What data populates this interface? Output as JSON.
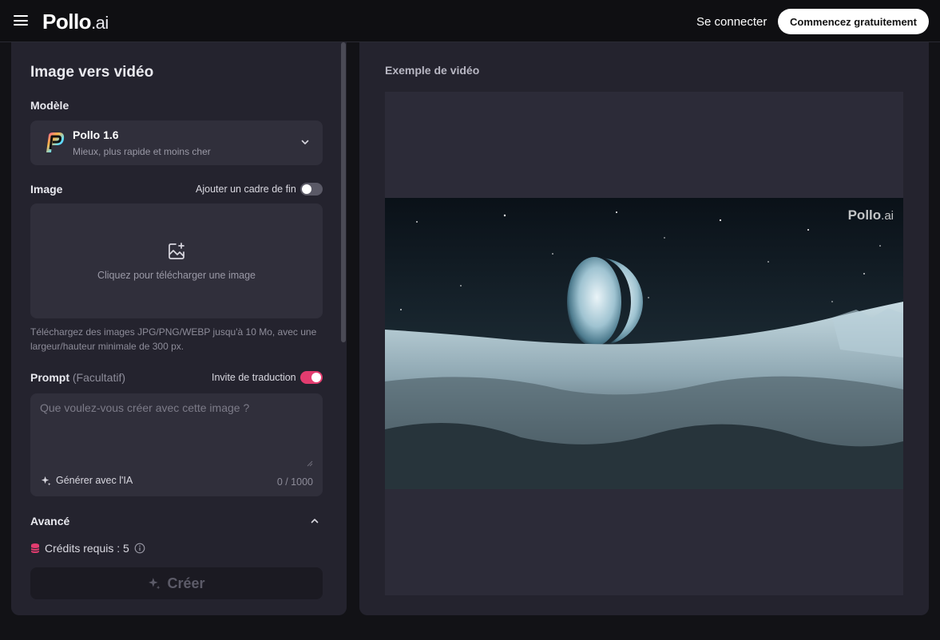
{
  "header": {
    "logo_main": "Pollo",
    "logo_suffix": ".ai",
    "signin_label": "Se connecter",
    "cta_label": "Commencez gratuitement"
  },
  "form": {
    "title": "Image vers vidéo",
    "model_label": "Modèle",
    "model": {
      "name": "Pollo 1.6",
      "description": "Mieux, plus rapide et moins cher"
    },
    "image_label": "Image",
    "end_frame_label": "Ajouter un cadre de fin",
    "end_frame_enabled": false,
    "upload_text": "Cliquez pour télécharger une image",
    "upload_hint": "Téléchargez des images JPG/PNG/WEBP jusqu'à 10 Mo, avec une largeur/hauteur minimale de 300 px.",
    "prompt_label": "Prompt",
    "prompt_optional": "(Facultatif)",
    "translate_label": "Invite de traduction",
    "translate_enabled": true,
    "prompt_placeholder": "Que voulez-vous créer avec cette image ?",
    "generate_ai_label": "Générer avec l'IA",
    "char_counter": "0 / 1000",
    "advanced_label": "Avancé",
    "credits_label": "Crédits requis : 5",
    "create_label": "Créer"
  },
  "preview": {
    "title": "Exemple de vidéo",
    "watermark_main": "Pollo",
    "watermark_suffix": ".ai"
  },
  "colors": {
    "accent": "#e23c6f",
    "panel": "#24232e",
    "background": "#121216"
  }
}
